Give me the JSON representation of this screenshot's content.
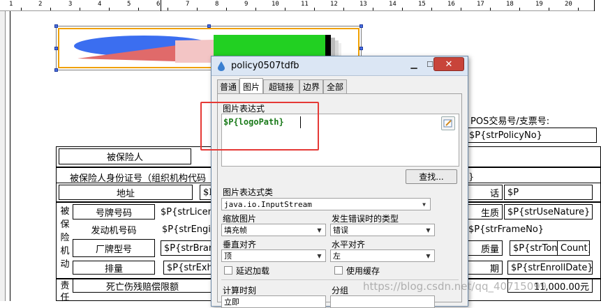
{
  "ruler": {
    "numbers": [
      "1",
      "2",
      "3",
      "4",
      "5",
      "6",
      "7",
      "8",
      "9",
      "10",
      "11",
      "12",
      "13",
      "14",
      "15",
      "16",
      "17",
      "18",
      "19",
      "20"
    ]
  },
  "report": {
    "insured_label": "被保险人",
    "pos_label": "POS交易号/支票号:",
    "policy_field": "$P{strPolicyNo}",
    "id_label": "被保险人身份证号（组织机构代码",
    "id_tail": "}",
    "address_label": "地址",
    "address_value": "$P",
    "phone_label": "话",
    "phone_value": "$P",
    "vehicle_group_label": [
      "被",
      "保",
      "险",
      "机",
      "动"
    ],
    "plate_label": "号牌号码",
    "plate_value": "$P{strLicen",
    "nature_label": "生质",
    "nature_value": "$P{strUseNature}",
    "engine_label": "发动机号码",
    "engine_value": "$P{strEngi",
    "frame_value": "$P{strFrameNo}",
    "brand_label": "厂牌型号",
    "brand_value": "$P{strBrand",
    "weight_label": "质量",
    "tonnage_value": "$P{strTon",
    "count_value": "Count}",
    "displacement_label": "排量",
    "displacement_value": "$P{strExha",
    "enroll_label": "期",
    "enroll_value": "$P{strEnrollDate}",
    "liability_label": "责",
    "liability_label2": "任",
    "death_label": "死亡伤残赔偿限额",
    "amount_value": "11,000.00元"
  },
  "dialog": {
    "title": "policy0507tdfb",
    "minimize_icon": "minimize-icon",
    "maximize_icon": "maximize-icon",
    "close_icon": "close-icon",
    "tabs": [
      {
        "label": "普通"
      },
      {
        "label": "图片"
      },
      {
        "label": "超链接"
      },
      {
        "label": "边界"
      },
      {
        "label": "全部"
      }
    ],
    "expr_label": "图片表达式",
    "expr_value": "$P{logoPath}",
    "find_button": "查找...",
    "class_label": "图片表达式类",
    "class_value": "java.io.InputStream",
    "scale_label": "缩放图片",
    "scale_value": "填充帧",
    "error_label": "发生错误时的类型",
    "error_value": "错误",
    "valign_label": "垂直对齐",
    "valign_value": "顶",
    "halign_label": "水平对齐",
    "halign_value": "左",
    "lazy_label": "延迟加载",
    "cache_label": "使用缓存",
    "eval_time_label": "计算时刻",
    "group_label": "分组",
    "eval_time_value": "立即"
  },
  "watermark": "https://blog.csdn.net/qq_40715099",
  "colors": {
    "highlight_box": "#e53935",
    "expression_text": "#1a7a1a",
    "titlebar": "#dbe6f4"
  }
}
